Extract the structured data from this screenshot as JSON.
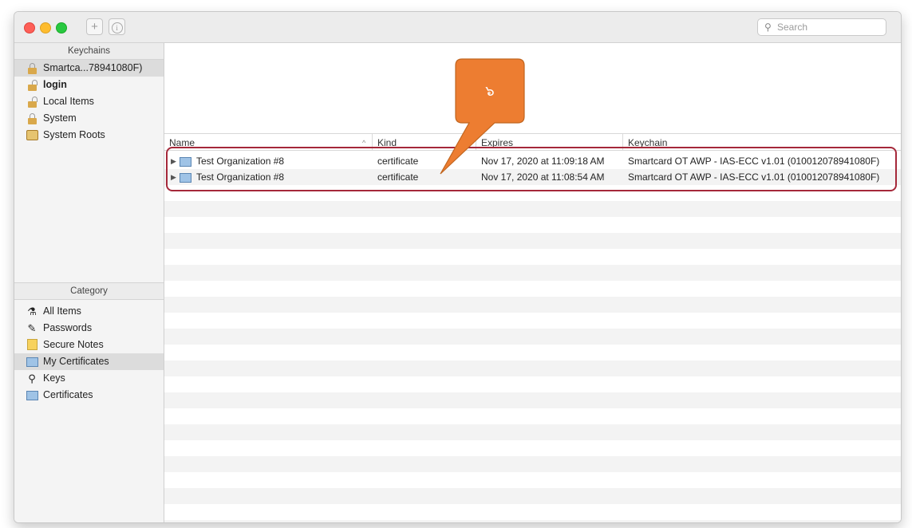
{
  "titlebar": {
    "search_placeholder": "Search"
  },
  "sidebar": {
    "keychains_header": "Keychains",
    "keychains": [
      {
        "label": "Smartca...78941080F)",
        "icon": "lock-closed-icon",
        "selected": true,
        "bold": false
      },
      {
        "label": "login",
        "icon": "lock-open-icon",
        "selected": false,
        "bold": true
      },
      {
        "label": "Local Items",
        "icon": "lock-open-icon",
        "selected": false,
        "bold": false
      },
      {
        "label": "System",
        "icon": "lock-closed-icon",
        "selected": false,
        "bold": false
      },
      {
        "label": "System Roots",
        "icon": "folder-icon",
        "selected": false,
        "bold": false
      }
    ],
    "category_header": "Category",
    "categories": [
      {
        "label": "All Items",
        "icon": "all-items-icon",
        "selected": false
      },
      {
        "label": "Passwords",
        "icon": "passwords-icon",
        "selected": false
      },
      {
        "label": "Secure Notes",
        "icon": "secure-notes-icon",
        "selected": false
      },
      {
        "label": "My Certificates",
        "icon": "my-certificates-icon",
        "selected": true
      },
      {
        "label": "Keys",
        "icon": "keys-icon",
        "selected": false
      },
      {
        "label": "Certificates",
        "icon": "certificates-icon",
        "selected": false
      }
    ]
  },
  "table": {
    "columns": [
      "Name",
      "Kind",
      "Expires",
      "Keychain"
    ],
    "rows": [
      {
        "name": "Test Organization #8",
        "kind": "certificate",
        "expires": "Nov 17, 2020 at 11:09:18 AM",
        "keychain": "Smartcard OT AWP - IAS-ECC v1.01 (010012078941080F)"
      },
      {
        "name": "Test Organization #8",
        "kind": "certificate",
        "expires": "Nov 17, 2020 at 11:08:54 AM",
        "keychain": "Smartcard OT AWP - IAS-ECC v1.01 (010012078941080F)"
      }
    ]
  },
  "annotation": {
    "callout_number": "๖",
    "callout_color": "#ed7d31",
    "highlight_color": "#a5283a"
  }
}
